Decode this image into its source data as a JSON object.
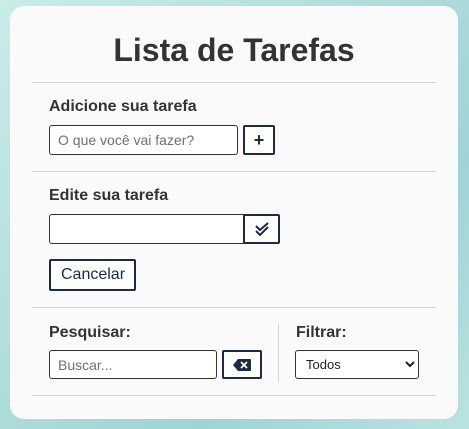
{
  "title": "Lista de Tarefas",
  "add_section": {
    "label": "Adicione sua tarefa",
    "input_value": "",
    "input_placeholder": "O que você vai fazer?",
    "add_button_label": "+"
  },
  "edit_section": {
    "label": "Edite sua tarefa",
    "input_value": "",
    "confirm_icon": "double-check-icon",
    "cancel_label": "Cancelar"
  },
  "search_section": {
    "label": "Pesquisar:",
    "input_placeholder": "Buscar...",
    "clear_icon": "backspace-icon"
  },
  "filter_section": {
    "label": "Filtrar:",
    "selected": "Todos"
  },
  "colors": {
    "accent": "#1c2a45",
    "card": "#fafafa",
    "text": "#333333"
  }
}
